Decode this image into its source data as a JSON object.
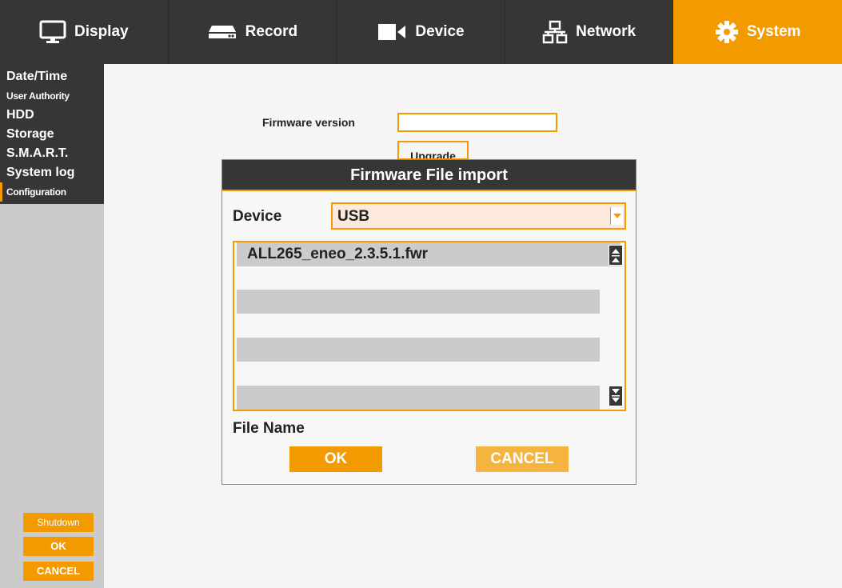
{
  "topnav": {
    "tabs": [
      {
        "label": "Display",
        "icon": "monitor-icon"
      },
      {
        "label": "Record",
        "icon": "hdd-recorder-icon"
      },
      {
        "label": "Device",
        "icon": "camera-icon"
      },
      {
        "label": "Network",
        "icon": "network-icon"
      },
      {
        "label": "System",
        "icon": "gear-icon"
      }
    ],
    "active_tab": "System"
  },
  "sidebar": {
    "items": [
      {
        "label": "Date/Time"
      },
      {
        "label": "User Authority"
      },
      {
        "label": "HDD"
      },
      {
        "label": "Storage"
      },
      {
        "label": "S.M.A.R.T."
      },
      {
        "label": "System log"
      },
      {
        "label": "Configuration"
      }
    ],
    "active_item": "Configuration",
    "buttons": {
      "shutdown": "Shutdown",
      "ok": "OK",
      "cancel": "CANCEL"
    }
  },
  "main": {
    "firmware_label": "Firmware version",
    "firmware_value": "",
    "upgrade_label": "Upgrade"
  },
  "dialog": {
    "title": "Firmware File import",
    "device_label": "Device",
    "device_value": "USB",
    "files": [
      "ALL265_eneo_2.3.5.1.fwr",
      "",
      "",
      "",
      "",
      ""
    ],
    "file_name_label": "File Name",
    "ok_label": "OK",
    "cancel_label": "CANCEL"
  },
  "colors": {
    "accent": "#f39a00",
    "dark": "#363636",
    "sidebar_bg": "#cbcbcb",
    "select_bg": "#fde9dc"
  }
}
